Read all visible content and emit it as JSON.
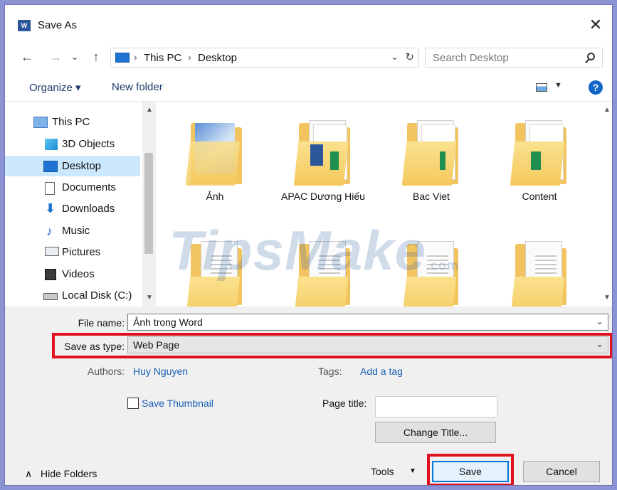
{
  "window": {
    "title": "Save As",
    "app_icon": "W",
    "close": "✕"
  },
  "nav": {
    "back": "←",
    "forward": "→",
    "recent": "⌄",
    "up": "↑",
    "breadcrumbs": [
      "This PC",
      "Desktop"
    ],
    "separator": "›",
    "dropdown": "⌄",
    "refresh": "↻",
    "search_placeholder": "Search Desktop"
  },
  "toolbar": {
    "organize": "Organize ▾",
    "new_folder": "New folder",
    "help": "?"
  },
  "sidebar": {
    "items": [
      {
        "label": "This PC",
        "icon": "pc-icon"
      },
      {
        "label": "3D Objects",
        "icon": "cube-icon"
      },
      {
        "label": "Desktop",
        "icon": "desktop-icon",
        "selected": true
      },
      {
        "label": "Documents",
        "icon": "document-icon"
      },
      {
        "label": "Downloads",
        "icon": "download-icon"
      },
      {
        "label": "Music",
        "icon": "music-icon"
      },
      {
        "label": "Pictures",
        "icon": "pictures-icon"
      },
      {
        "label": "Videos",
        "icon": "video-icon"
      },
      {
        "label": "Local Disk (C:)",
        "icon": "disk-icon"
      }
    ],
    "scroll_up": "▲",
    "scroll_down": "▼"
  },
  "files": {
    "folders": [
      {
        "name": "Ảnh",
        "variant": "photo"
      },
      {
        "name": "APAC Dương Hiếu",
        "variant": "word"
      },
      {
        "name": "Bac Viet",
        "variant": "doc"
      },
      {
        "name": "Content",
        "variant": "excel"
      },
      {
        "name": "",
        "variant": "doc"
      },
      {
        "name": "",
        "variant": "doc"
      },
      {
        "name": "",
        "variant": "doc"
      },
      {
        "name": "",
        "variant": "doc"
      }
    ],
    "scroll_up": "▲",
    "scroll_down": "▼"
  },
  "watermark": {
    "text": "TipsMake",
    "suffix": ".com"
  },
  "form": {
    "file_name_label": "File name:",
    "file_name_value": "Ảnh trong Word",
    "save_type_label": "Save as type:",
    "save_type_value": "Web Page",
    "chevron": "⌄",
    "authors_label": "Authors:",
    "authors_value": "Huy Nguyen",
    "tags_label": "Tags:",
    "tags_value": "Add a tag",
    "thumbnail_label": "Save Thumbnail",
    "page_title_label": "Page title:",
    "page_title_value": "",
    "change_title": "Change Title..."
  },
  "footer": {
    "hide_folders": "Hide Folders",
    "hide_chevron": "∧",
    "tools": "Tools",
    "tools_drop": "▼",
    "save": "Save",
    "cancel": "Cancel"
  },
  "colors": {
    "highlight": "#e0101e",
    "selected": "#cce8ff",
    "link": "#1a5fb4",
    "frame": "#8c93d4"
  }
}
